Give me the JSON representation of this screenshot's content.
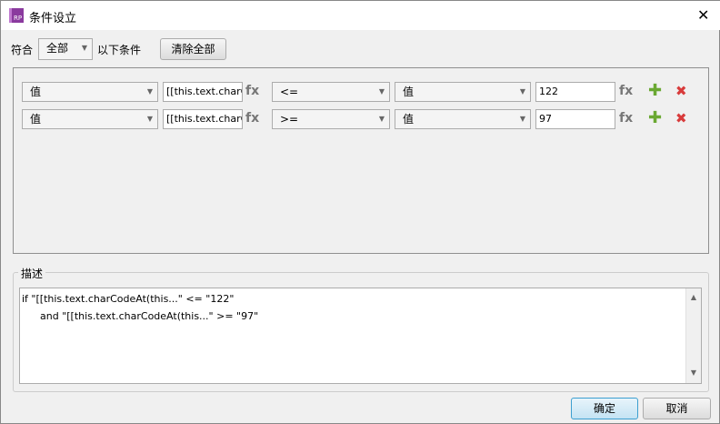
{
  "window": {
    "title": "条件设立",
    "logo": "RP"
  },
  "header": {
    "match_label": "符合",
    "match_value": "全部",
    "suffix_label": "以下条件",
    "clear_all": "清除全部"
  },
  "conditions": [
    {
      "left_type": "值",
      "left_value": "[[this.text.charCo",
      "operator": "<=",
      "right_type": "值",
      "right_value": "122"
    },
    {
      "left_type": "值",
      "left_value": "[[this.text.charCo",
      "operator": ">=",
      "right_type": "值",
      "right_value": "97"
    }
  ],
  "labels": {
    "fx": "fx",
    "plus": "✚",
    "delete": "✖",
    "close": "✕"
  },
  "description": {
    "label": "描述",
    "line1": "if \"[[this.text.charCodeAt(this...\" <= \"122\"",
    "line2": "and \"[[this.text.charCodeAt(this...\" >= \"97\""
  },
  "footer": {
    "ok": "确定",
    "cancel": "取消"
  }
}
